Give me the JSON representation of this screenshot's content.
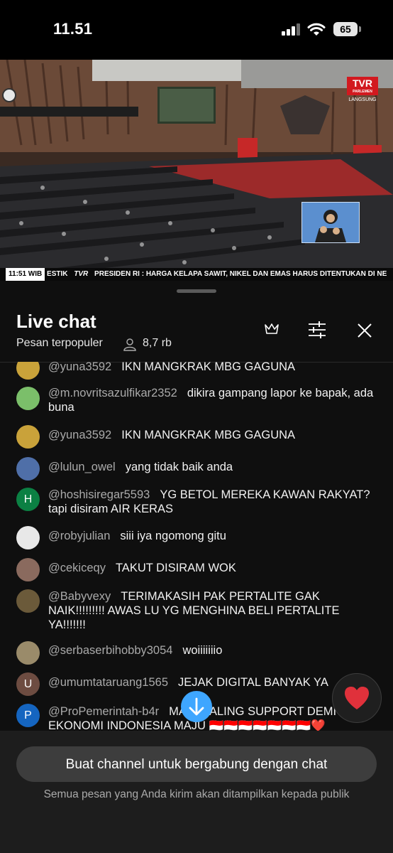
{
  "status": {
    "time": "11.51",
    "battery": "65"
  },
  "video": {
    "channel_logo": "TVR",
    "channel_sub": "PARLEMEN",
    "live_label": "LANGSUNG",
    "ticker_time": "11:51 WIB",
    "ticker_prefix": "ESTIK",
    "ticker_brand": "TVR",
    "ticker_text": "PRESIDEN RI : HARGA KELAPA SAWIT, NIKEL DAN EMAS HARUS DITENTUKAN DI NE"
  },
  "chat": {
    "title": "Live chat",
    "subtitle": "Pesan terpopuler",
    "viewer_count": "8,7 rb",
    "icons": {
      "crown": "crown-icon",
      "filter": "sliders-icon",
      "close": "close-icon",
      "viewers": "person-icon",
      "scroll": "arrow-down-icon",
      "heart": "heart-icon"
    },
    "messages": [
      {
        "author": "@yuna3592",
        "text": "IKN MANGKRAK MBG GAGUNA",
        "avatar_color": "#c9a23a",
        "avatar_letter": ""
      },
      {
        "author": "@m.novritsazulfikar2352",
        "text": "dikira gampang lapor ke bapak, ada buna",
        "avatar_color": "#7bbf6a",
        "avatar_letter": ""
      },
      {
        "author": "@yuna3592",
        "text": "IKN MANGKRAK MBG GAGUNA",
        "avatar_color": "#c9a23a",
        "avatar_letter": ""
      },
      {
        "author": "@lulun_owel",
        "text": "yang tidak baik anda",
        "avatar_color": "#4f6fa8",
        "avatar_letter": ""
      },
      {
        "author": "@hoshisiregar5593",
        "text": "YG BETOL MEREKA KAWAN RAKYAT? tapi disiram AIR KERAS",
        "avatar_color": "#0b8043",
        "avatar_letter": "H"
      },
      {
        "author": "@robyjulian",
        "text": "siii iya ngomong gitu",
        "avatar_color": "#e8e8e8",
        "avatar_letter": ""
      },
      {
        "author": "@cekiceqy",
        "text": "TAKUT DISIRAM WOK",
        "avatar_color": "#8a6a5e",
        "avatar_letter": ""
      },
      {
        "author": "@Babyvexy",
        "text": "TERIMAKASIH PAK PERTALITE GAK NAIK!!!!!!!!! AWAS LU YG MENGHINA BELI PERTALITE YA!!!!!!!",
        "avatar_color": "#6b5a3a",
        "avatar_letter": ""
      },
      {
        "author": "@serbaserbihobby3054",
        "text": "woiiiiiiio",
        "avatar_color": "#9a8b6a",
        "avatar_letter": ""
      },
      {
        "author": "@umumtataruang1565",
        "text": "JEJAK DIGITAL BANYAK YA",
        "avatar_color": "#6d4c41",
        "avatar_letter": "U"
      },
      {
        "author": "@ProPemerintah-b4r",
        "text": "MARI SALING SUPPORT DEMI EKONOMI INDONESIA MAJU 🇮🇩🇮🇩🇮🇩🇮🇩🇮🇩🇮🇩🇮🇩❤️",
        "avatar_color": "#1565c0",
        "avatar_letter": "P"
      }
    ]
  },
  "footer": {
    "join_button": "Buat channel untuk bergabung dengan chat",
    "notice": "Semua pesan yang Anda kirim akan ditampilkan kepada publik"
  }
}
